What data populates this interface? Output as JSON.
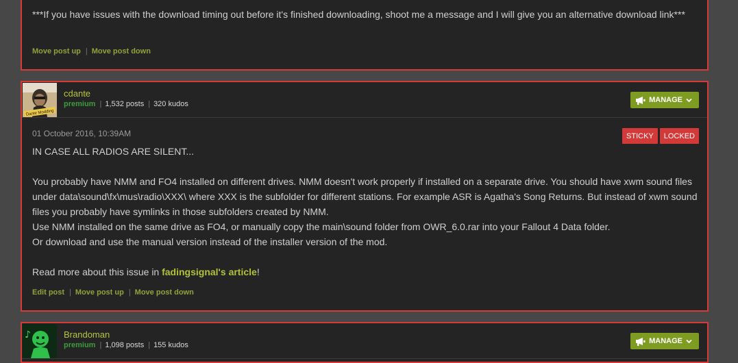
{
  "post1": {
    "body": "***If you have issues with the download timing out before it's finished downloading, shoot me a message and I will give you an alternative download link***",
    "actions": [
      "Move post up",
      "Move post down"
    ]
  },
  "post2": {
    "username": "cdante",
    "rank": "premium",
    "posts": "1,532 posts",
    "kudos": "320 kudos",
    "manage_label": "MANAGE",
    "date": "01 October 2016, 10:39AM",
    "badges": [
      "STICKY",
      "LOCKED"
    ],
    "heading": "IN CASE ALL RADIOS ARE SILENT...",
    "para1": "You probably have NMM and FO4 installed on different drives. NMM doesn't work properly if installed on a separate drive. You should have xwm sound files under data\\sound\\fx\\mus\\radio\\XXX\\ where XXX is the subfolder for different stations. For example ASR is Agatha's Song Returns. But instead of xwm sound files you probably have symlinks in those subfolders created by NMM.",
    "para2": "Use NMM installed on the same drive as FO4, or manually copy the main\\sound folder from OWR_6.0.rar into your Fallout 4 Data folder.",
    "para3": "Or download and use the manual version instead of the installer version of the mod.",
    "read_more_prefix": "Read more about this issue in ",
    "read_more_link": "fadingsignal's article",
    "read_more_suffix": "!",
    "actions": [
      "Edit post",
      "Move post up",
      "Move post down"
    ]
  },
  "post3": {
    "username": "Brandoman",
    "rank": "premium",
    "posts": "1,098 posts",
    "kudos": "155 kudos",
    "manage_label": "MANAGE"
  },
  "colors": {
    "border": "#d83a3a",
    "manage": "#7e9b22",
    "link": "#b2c13b",
    "premium": "#3d9c3d",
    "badge": "#d23a3a"
  },
  "icons": [
    "megaphone-icon",
    "chevron-down-icon"
  ]
}
